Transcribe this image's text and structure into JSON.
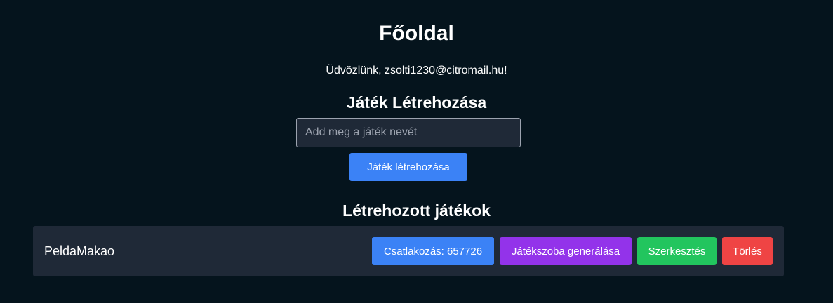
{
  "header": {
    "title": "Főoldal",
    "welcome": "Üdvözlünk, zsolti1230@citromail.hu!"
  },
  "create": {
    "heading": "Játék Létrehozása",
    "input_placeholder": "Add meg a játék nevét",
    "input_value": "",
    "button_label": "Játék létrehozása"
  },
  "games": {
    "heading": "Létrehozott játékok",
    "items": [
      {
        "name": "PeldaMakao",
        "join_label": "Csatlakozás: 657726",
        "room_label": "Játékszoba generálása",
        "edit_label": "Szerkesztés",
        "delete_label": "Törlés"
      }
    ]
  },
  "colors": {
    "background": "#05141d",
    "panel": "#1f2937",
    "primary": "#3b82f6",
    "purple": "#9333ea",
    "green": "#22c55e",
    "red": "#ef4444"
  }
}
